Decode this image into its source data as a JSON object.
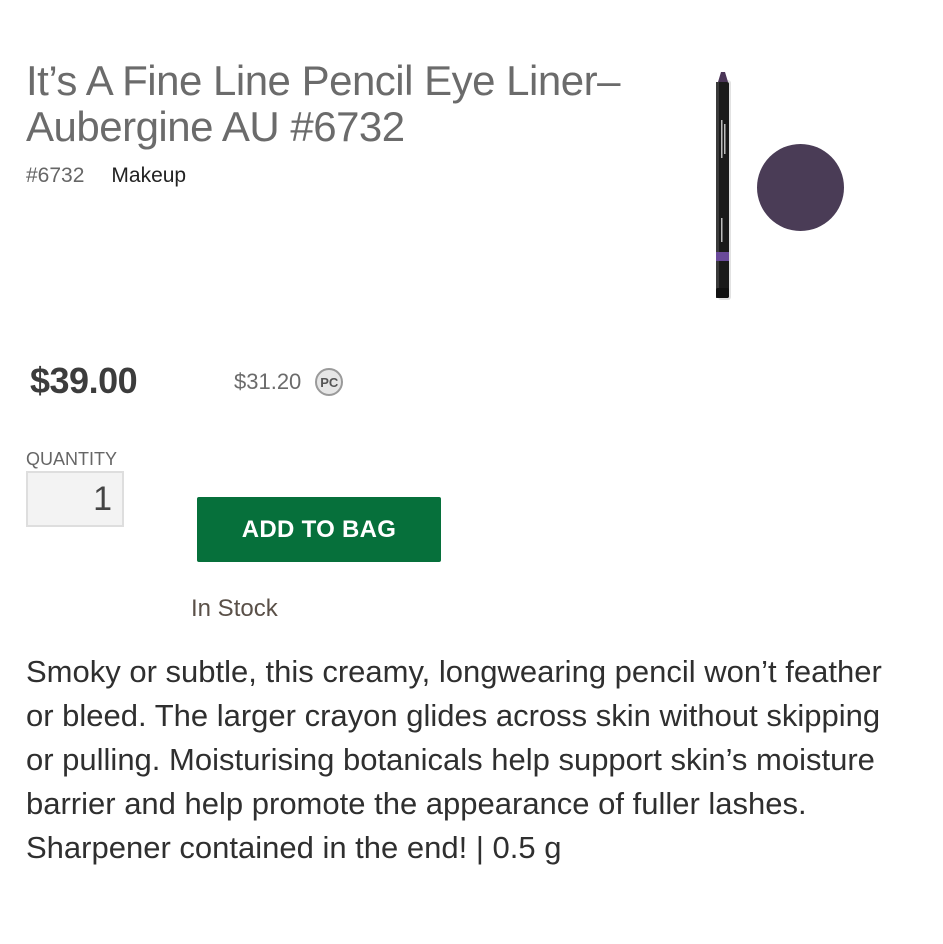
{
  "product": {
    "title": "It’s A Fine Line Pencil Eye Liner– Aubergine AU #6732",
    "sku": "#6732",
    "category": "Makeup",
    "image_icon": "eyeliner-pencil-image",
    "swatch_color": "#4a3c56"
  },
  "pricing": {
    "price": "$39.00",
    "pc_price": "$31.20",
    "pc_badge": "PC"
  },
  "purchase": {
    "quantity_label": "QUANTITY",
    "quantity_value": "1",
    "add_to_bag_label": "ADD TO BAG",
    "button_color": "#06703b",
    "stock_status": "In Stock"
  },
  "description": "Smoky or subtle, this creamy, longwearing pencil won’t feather or bleed. The larger crayon glides across skin without skipping or pulling. Moisturising botanicals help support skin’s moisture barrier and help promote the appearance of fuller lashes. Sharpener contained in the end! | 0.5 g"
}
